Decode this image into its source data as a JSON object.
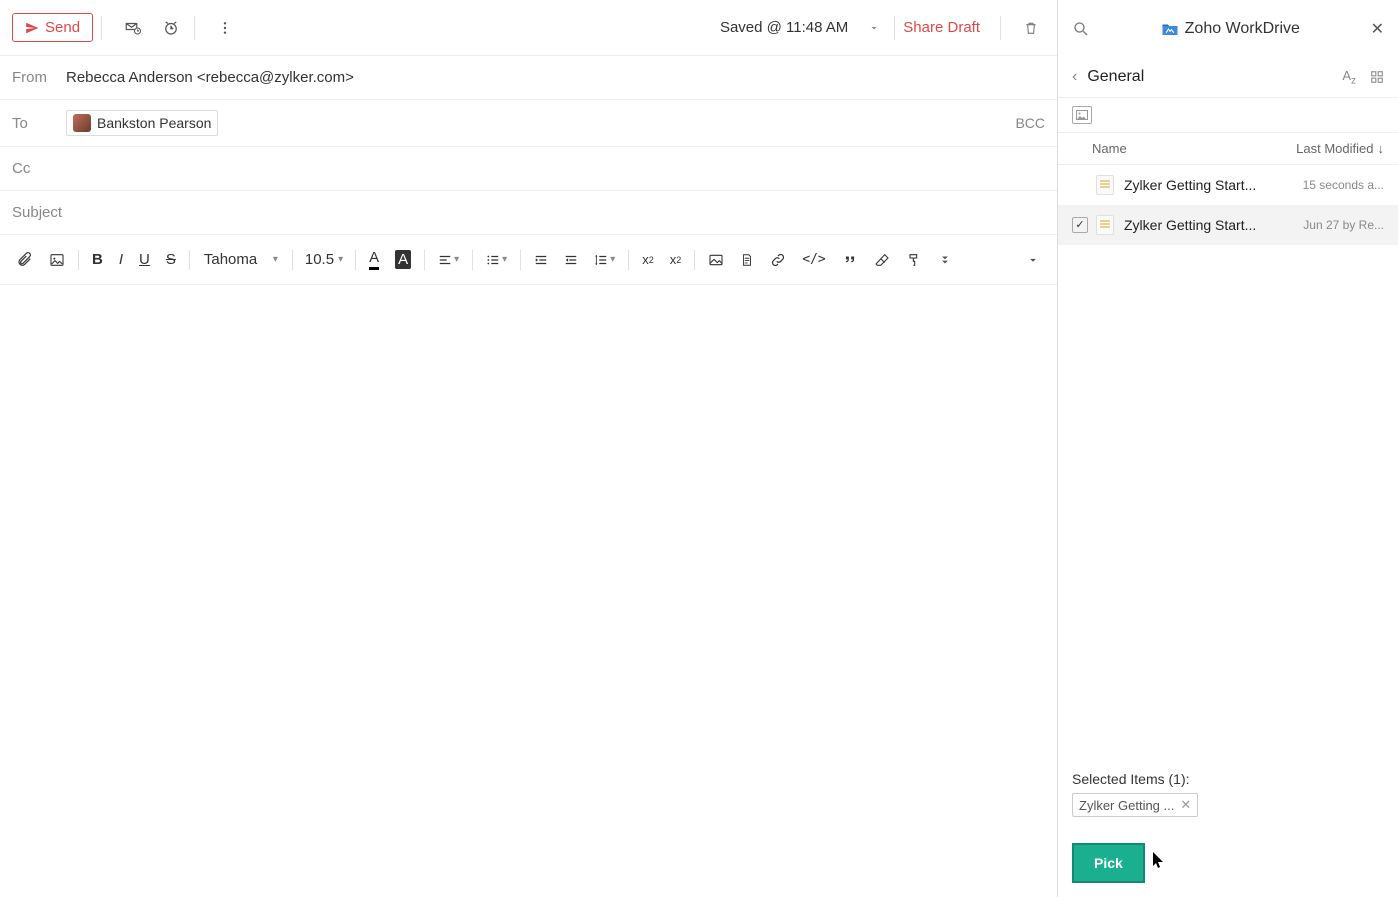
{
  "topbar": {
    "send": "Send",
    "saved": "Saved @ 11:48 AM",
    "share": "Share Draft"
  },
  "header": {
    "from_label": "From",
    "from_value": "Rebecca Anderson <rebecca@zylker.com>",
    "to_label": "To",
    "to_chip": "Bankston Pearson",
    "bcc": "BCC",
    "cc_label": "Cc",
    "subject_placeholder": "Subject"
  },
  "toolbar": {
    "font": "Tahoma",
    "size": "10.5"
  },
  "sidebar": {
    "title": "Zoho WorkDrive",
    "folder": "General",
    "col_name": "Name",
    "col_mod": "Last Modified",
    "files": [
      {
        "name": "Zylker Getting Start...",
        "modified": "15 seconds a...",
        "selected": false
      },
      {
        "name": "Zylker Getting Start...",
        "modified": "Jun 27 by Re...",
        "selected": true
      }
    ],
    "selected_label": "Selected Items (1):",
    "selected_chip": "Zylker Getting ...",
    "pick": "Pick"
  }
}
